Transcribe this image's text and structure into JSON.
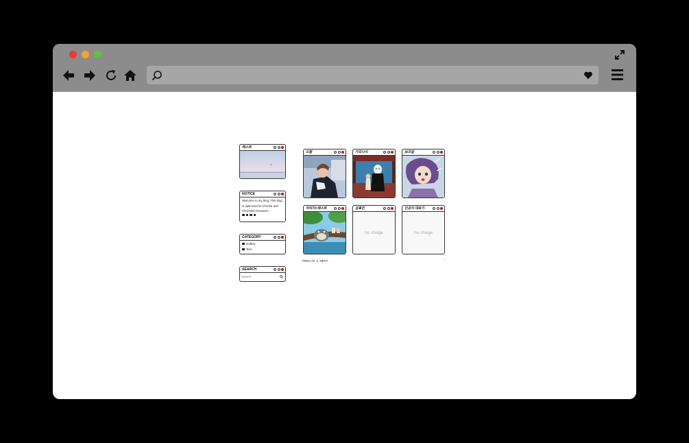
{
  "browser": {
    "url_placeholder": "",
    "controls": [
      "back-icon",
      "forward-icon",
      "reload-icon",
      "home-icon",
      "search-icon",
      "heart-icon",
      "menu-icon",
      "expand-icon"
    ],
    "traffic_lights": {
      "close": "#ee3a34",
      "minimize": "#f5a623",
      "maximize": "#5ac444"
    }
  },
  "sidebar": {
    "test_widget": {
      "title": "테스트"
    },
    "notice": {
      "title": "NOTICE",
      "lines": [
        "Welcome to my blog. This blog",
        "is optimized for chrome and",
        "Chromium browsers."
      ]
    },
    "category": {
      "title": "CATEGORY",
      "items": [
        "Gallery",
        "Text"
      ]
    },
    "search": {
      "title": "SEARCH",
      "placeholder": "Search"
    }
  },
  "gallery": {
    "posts": [
      {
        "title": "드랄",
        "image": "photo"
      },
      {
        "title": "가오나시",
        "image": "photo"
      },
      {
        "title": "보조갈",
        "image": "photo"
      },
      {
        "title": "이미지+테스트",
        "image": "photo"
      },
      {
        "title": "공효진",
        "image": "none",
        "no_image_label": "no image"
      },
      {
        "title": "인공지 대로기",
        "image": "none",
        "no_image_label": "no image"
      }
    ],
    "pagination": {
      "prev": "PREV",
      "current": "/2/",
      "page": "2",
      "next": "NEXT"
    },
    "corner_mark": "^"
  }
}
